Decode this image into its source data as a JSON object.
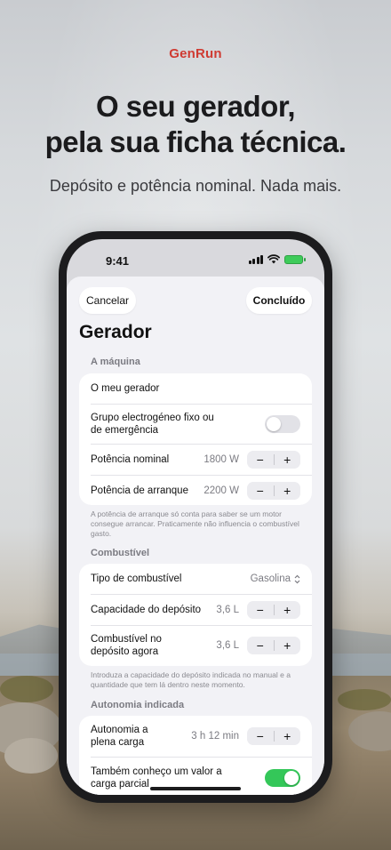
{
  "brand": "GenRun",
  "headline": {
    "line1": "O seu gerador,",
    "line2": "pela sua ficha técnica."
  },
  "subline": "Depósito e potência nominal. Nada mais.",
  "status": {
    "time": "9:41"
  },
  "nav": {
    "cancel": "Cancelar",
    "done": "Concluído"
  },
  "title": "Gerador",
  "machine": {
    "header": "A máquina",
    "name": "O meu gerador",
    "standby_line1": "Grupo electrogéneo fixo ou",
    "standby_line2": "de emergência",
    "standby_on": false,
    "rated_label": "Potência nominal",
    "rated_value": "1800 W",
    "starting_label": "Potência de arranque",
    "starting_value": "2200 W",
    "footnote": "A potência de arranque só conta para saber se um motor consegue arrancar. Praticamente não influencia o combustível gasto."
  },
  "fuel": {
    "header": "Combustível",
    "type_label": "Tipo de combustível",
    "type_value": "Gasolina",
    "capacity_label": "Capacidade do depósito",
    "capacity_value": "3,6 L",
    "current_line1": "Combustível no",
    "current_line2": "depósito agora",
    "current_value": "3,6 L",
    "footnote": "Introduza a capacidade do depósito indicada no manual e a quantidade que tem lá dentro neste momento."
  },
  "runtime": {
    "header": "Autonomia indicada",
    "full_line1": "Autonomia a",
    "full_line2": "plena carga",
    "full_value": "3 h 12 min",
    "partial_line1": "Também conheço um valor a",
    "partial_line2": "carga parcial",
    "partial_on": true
  },
  "stepper": {
    "minus": "−",
    "plus": "+"
  },
  "colors": {
    "brand": "#cf3b32",
    "toggle_on": "#34c759",
    "toggle_off": "#e2e2e7"
  }
}
